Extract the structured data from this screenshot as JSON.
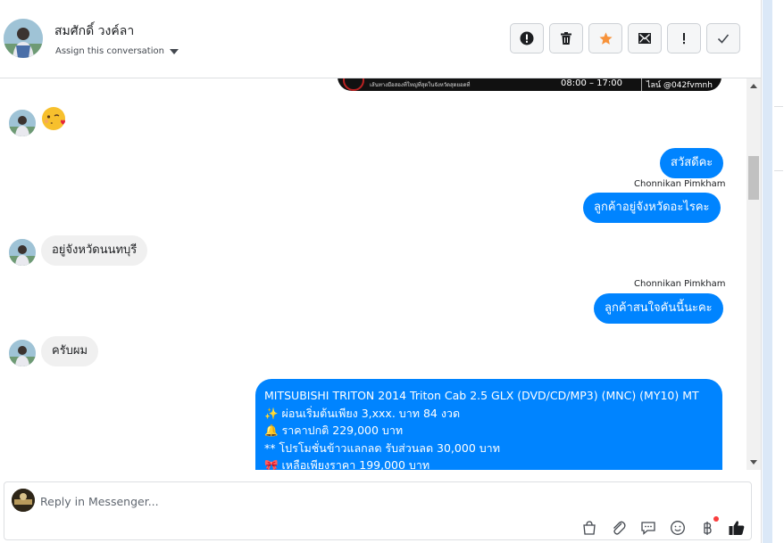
{
  "header": {
    "contact_name": "สมศักดิ์ วงค์ลา",
    "assign_label": "Assign this conversation",
    "actions": [
      {
        "name": "spam-button",
        "icon": "exclamation-circle-icon"
      },
      {
        "name": "delete-button",
        "icon": "trash-icon"
      },
      {
        "name": "star-button",
        "icon": "star-icon",
        "color": "#f7923a"
      },
      {
        "name": "mark-unread-button",
        "icon": "envelope-icon"
      },
      {
        "name": "follow-up-button",
        "icon": "exclamation-icon"
      },
      {
        "name": "done-button",
        "icon": "check-icon"
      }
    ]
  },
  "banner": {
    "caption": "เส้นทางมือสองที่ใหญ่ที่สุดในจังหวัดสุดยอดที่",
    "hours": "08:00 – 17:00",
    "line_id": "ไลน์ @042fvmnh"
  },
  "messages": [
    {
      "id": "m1",
      "direction": "in",
      "type": "emoji",
      "emoji": "😘"
    },
    {
      "id": "m2",
      "direction": "out",
      "text": "สวัสดีคะ"
    },
    {
      "id": "m3",
      "direction": "out",
      "sender": "Chonnikan Pimkham",
      "text": "ลูกค้าอยู่จังหวัดอะไรคะ"
    },
    {
      "id": "m4",
      "direction": "in",
      "text": "อยู่จังหวัดนนทบุรี"
    },
    {
      "id": "m5",
      "direction": "out",
      "sender": "Chonnikan Pimkham",
      "text": "ลูกค้าสนใจคันนี้นะคะ"
    },
    {
      "id": "m6",
      "direction": "in",
      "text": "ครับผม"
    },
    {
      "id": "m7",
      "direction": "out",
      "lines": [
        "MITSUBISHI TRITON 2014 Triton Cab 2.5 GLX (DVD/CD/MP3) (MNC) (MY10) MT",
        "✨  ผ่อนเริ่มต้นเพียง 3,xxx. บาท 84 งวด",
        "🔔  ราคาปกติ 229,000 บาท",
        "** โปรโมชั่นข้าวแลกลด รับส่วนลด 30,000 บาท",
        "🎀  เหลือเพียงราคา 199,000 บาท"
      ]
    }
  ],
  "composer": {
    "placeholder": "Reply in Messenger...",
    "tools": [
      "shopping-bag-icon",
      "paperclip-icon",
      "saved-reply-icon",
      "emoji-icon",
      "baht-payment-icon",
      "thumbs-up-icon"
    ]
  },
  "colors": {
    "outgoing_bubble": "#0084ff",
    "incoming_bubble": "#f0f0f0",
    "star_accent": "#f7923a"
  }
}
